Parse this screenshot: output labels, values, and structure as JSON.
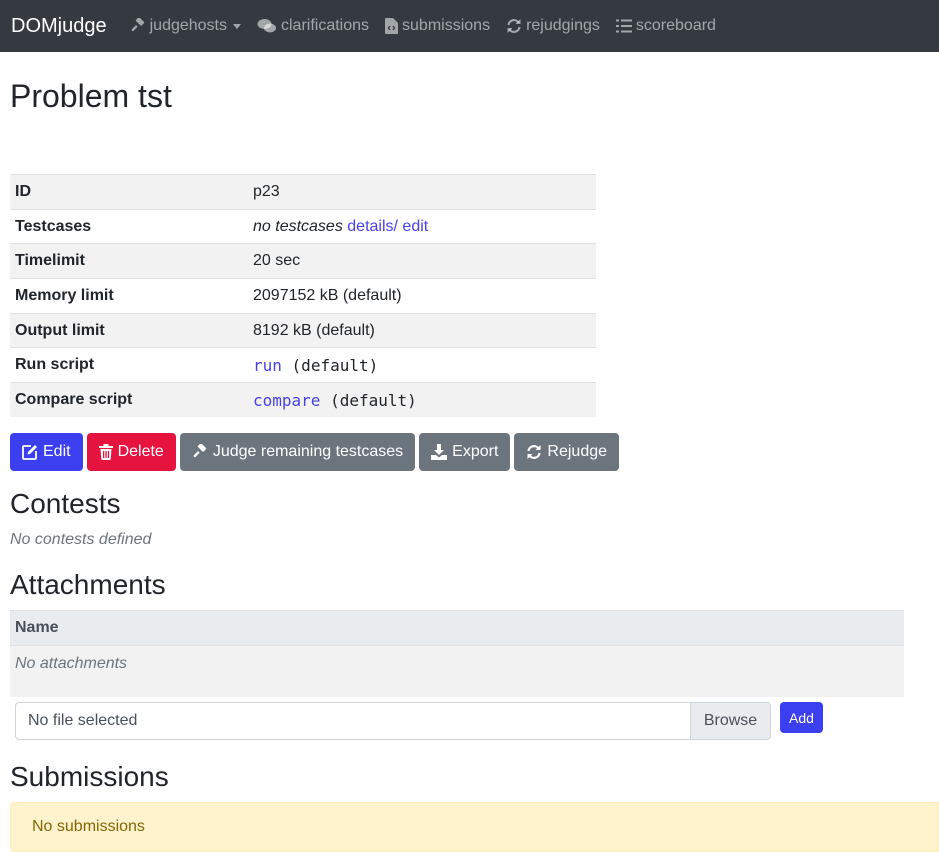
{
  "navbar": {
    "brand": "DOMjudge",
    "items": [
      {
        "label": "judgehosts",
        "icon": "gavel-icon",
        "dropdown": true
      },
      {
        "label": "clarifications",
        "icon": "comments-icon"
      },
      {
        "label": "submissions",
        "icon": "file-code-icon"
      },
      {
        "label": "rejudgings",
        "icon": "sync-icon"
      },
      {
        "label": "scoreboard",
        "icon": "list-ol-icon"
      }
    ]
  },
  "page": {
    "title": "Problem tst"
  },
  "props": {
    "id": {
      "label": "ID",
      "value": "p23"
    },
    "testcases": {
      "label": "Testcases",
      "value": "no testcases",
      "details_link": "details/ edit"
    },
    "timelimit": {
      "label": "Timelimit",
      "value": "20 sec"
    },
    "memory": {
      "label": "Memory limit",
      "value": "2097152 kB (default)"
    },
    "output": {
      "label": "Output limit",
      "value": "8192 kB (default)"
    },
    "run": {
      "label": "Run script",
      "link": "run",
      "suffix": "(default)"
    },
    "compare": {
      "label": "Compare script",
      "link": "compare",
      "suffix": "(default)"
    }
  },
  "actions": {
    "edit": "Edit",
    "delete": "Delete",
    "judge_remaining": "Judge remaining testcases",
    "export": "Export",
    "rejudge": "Rejudge"
  },
  "contests": {
    "heading": "Contests",
    "empty": "No contests defined"
  },
  "attachments": {
    "heading": "Attachments",
    "column_name": "Name",
    "empty": "No attachments",
    "file_placeholder": "No file selected",
    "browse": "Browse",
    "add": "Add"
  },
  "submissions": {
    "heading": "Submissions",
    "empty": "No submissions"
  },
  "colors": {
    "navbar": "#343a40",
    "primary": "#3b3ff0",
    "danger": "#e6133f",
    "secondary": "#6c757d",
    "link": "#4841e5",
    "alert_bg": "#fff3cd"
  }
}
